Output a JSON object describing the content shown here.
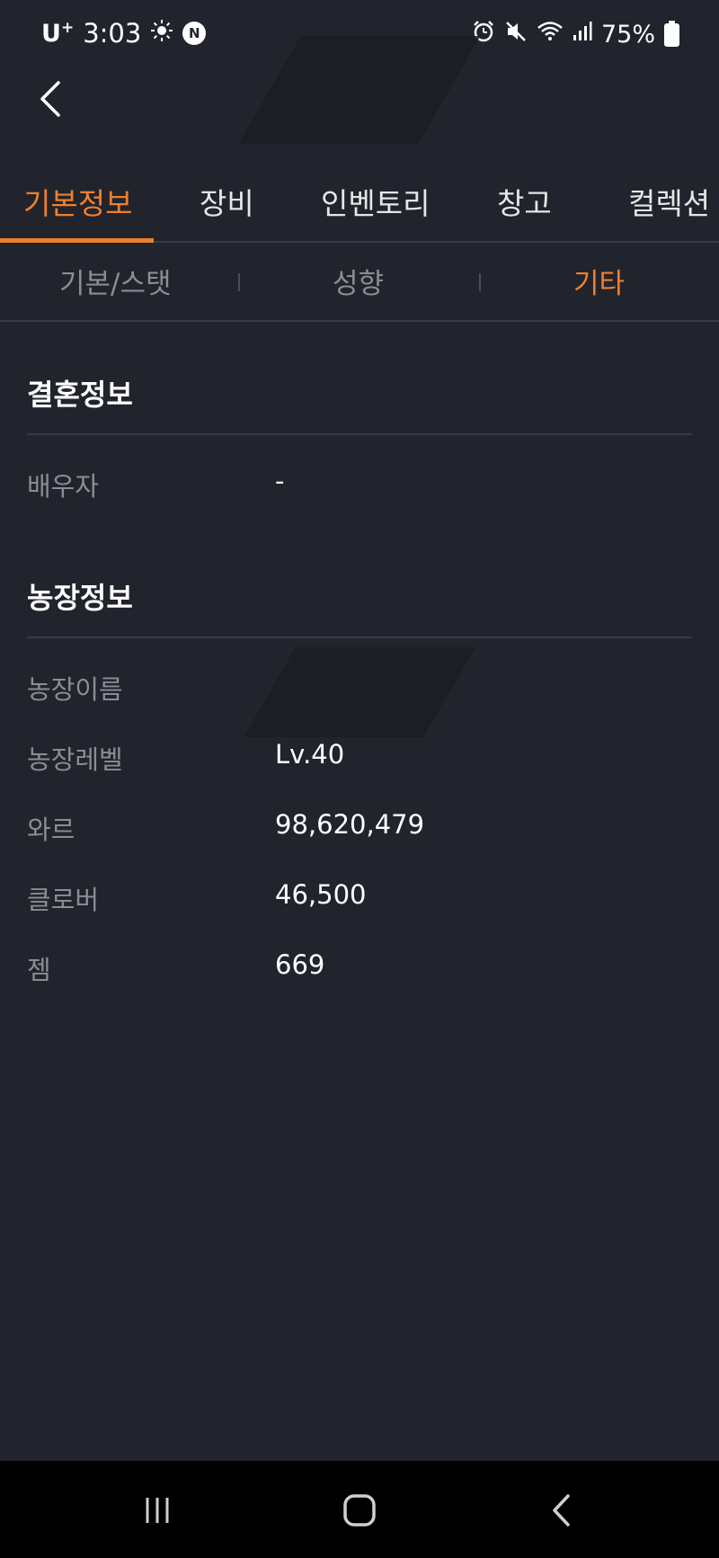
{
  "status_bar": {
    "carrier": "U",
    "carrier_sup": "+",
    "time": "3:03",
    "battery_percent": "75%",
    "icons": [
      "brightness-icon",
      "n-badge-icon",
      "alarm-icon",
      "mute-icon",
      "wifi-icon",
      "signal-icon",
      "battery-icon"
    ]
  },
  "header": {
    "back_icon": "chevron-left-icon"
  },
  "main_tabs": [
    {
      "label": "기본정보",
      "active": true
    },
    {
      "label": "장비",
      "active": false
    },
    {
      "label": "인벤토리",
      "active": false
    },
    {
      "label": "창고",
      "active": false
    },
    {
      "label": "컬렉션",
      "active": false
    }
  ],
  "sub_tabs": [
    {
      "label": "기본/스탯",
      "active": false
    },
    {
      "label": "성향",
      "active": false
    },
    {
      "label": "기타",
      "active": true
    }
  ],
  "marriage": {
    "title": "결혼정보",
    "rows": [
      {
        "label": "배우자",
        "value": "-"
      }
    ]
  },
  "farm": {
    "title": "농장정보",
    "rows": [
      {
        "label": "농장이름",
        "value": ""
      },
      {
        "label": "농장레벨",
        "value": "Lv.40"
      },
      {
        "label": "와르",
        "value": "98,620,479"
      },
      {
        "label": "클로버",
        "value": "46,500"
      },
      {
        "label": "젬",
        "value": "669"
      }
    ]
  },
  "colors": {
    "background": "#21242c",
    "accent": "#f07f2c",
    "muted_text": "#8a8d95",
    "nav_bar": "#000000"
  },
  "nav_bar": {
    "icons": [
      "recent-apps-icon",
      "home-icon",
      "back-icon"
    ]
  }
}
